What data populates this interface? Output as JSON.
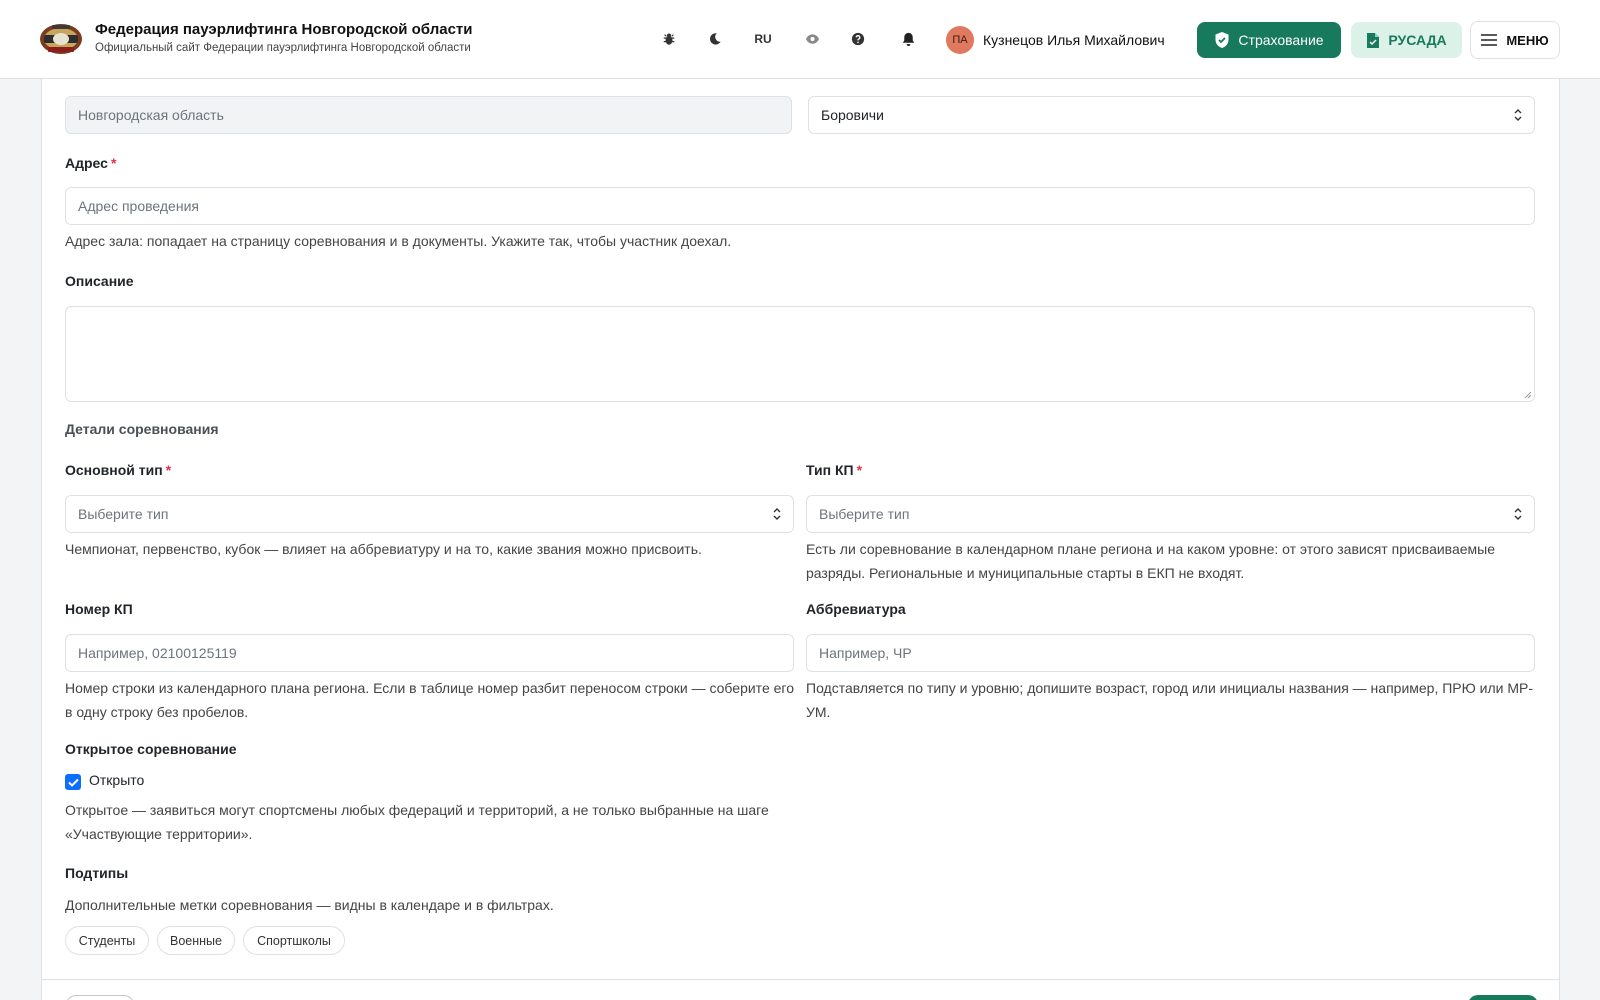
{
  "header": {
    "org_title": "Федерация пауэрлифтинга Новгородской области",
    "org_subtitle": "Официальный сайт Федерации пауэрлифтинга Новгородской области",
    "lang": "RU",
    "user_initials": "ПА",
    "user_name": "Кузнецов Илья Михайлович",
    "insurance_label": "Страхование",
    "rusada_label": "РУСАДА",
    "menu_label": "МЕНЮ",
    "icons": [
      "bug-icon",
      "moon-icon",
      "eye-icon",
      "help-icon",
      "bell-icon"
    ]
  },
  "form": {
    "region_value": "Новгородская область",
    "city_value": "Боровичи",
    "address": {
      "label": "Адрес",
      "required": "*",
      "placeholder": "Адрес проведения",
      "help": "Адрес зала: попадает на страницу соревнования и в документы. Укажите так, чтобы участник доехал."
    },
    "description": {
      "label": "Описание"
    },
    "details_title": "Детали соревнования",
    "main_type": {
      "label": "Основной тип",
      "required": "*",
      "placeholder": "Выберите тип",
      "help": "Чемпионат, первенство, кубок — влияет на аббревиатуру и на то, какие звания можно присвоить."
    },
    "kp_type": {
      "label": "Тип КП",
      "required": "*",
      "placeholder": "Выберите тип",
      "help": "Есть ли соревнование в календарном плане региона и на каком уровне: от этого зависят присваиваемые разряды. Региональные и муниципальные старты в ЕКП не входят."
    },
    "kp_number": {
      "label": "Номер КП",
      "placeholder": "Например, 02100125119",
      "help": "Номер строки из календарного плана региона. Если в таблице номер разбит переносом строки — соберите его в одну строку без пробелов."
    },
    "abbreviation": {
      "label": "Аббревиатура",
      "placeholder": "Например, ЧР",
      "help": "Подставляется по типу и уровню; допишите возраст, город или инициалы названия — например, ПРЮ или МР-УМ."
    },
    "open": {
      "label": "Открытое соревнование",
      "checkbox_label": "Открыто",
      "checked": true,
      "help": "Открытое — заявиться могут спортсмены любых федераций и территорий, а не только выбранные на шаге «Участвующие территории»."
    },
    "subtypes": {
      "label": "Подтипы",
      "help": "Дополнительные метки соревнования — видны в календаре и в фильтрах.",
      "chips": [
        "Студенты",
        "Военные",
        "Спортшколы"
      ]
    }
  },
  "colors": {
    "accent": "#177a5c",
    "accent_light": "#dcf1e8",
    "required": "#dc3545",
    "checkbox": "#0d6efd"
  }
}
